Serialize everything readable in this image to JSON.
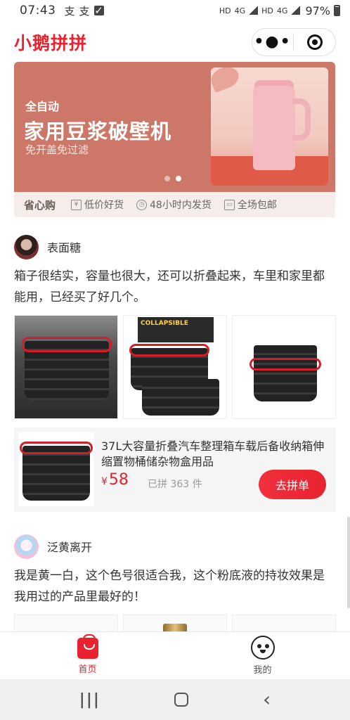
{
  "status_bar": {
    "time": "07:43",
    "notif_glyphs": [
      "支",
      "支"
    ],
    "net1": "HD",
    "net2": "4G",
    "net3": "HD",
    "net4": "4G",
    "battery": "97%"
  },
  "header": {
    "title": "小鹅拼拼",
    "more_glyph": "•●•"
  },
  "banner": {
    "small": "全自动",
    "headline": "家用豆浆破壁机",
    "subline": "免开盖免过滤",
    "slide_count": 2,
    "active_slide": 2
  },
  "features": {
    "title": "省心购",
    "items": [
      "低价好货",
      "48小时内发货",
      "全场包邮"
    ]
  },
  "posts": [
    {
      "author": "表面糖",
      "text": "箱子很结实，容量也很大，还可以折叠起来，车里和家里都能用，已经买了好几个。",
      "image_label": "COLLAPSIBLE",
      "product": {
        "name": "37L大容量折叠汽车整理箱车载后备收纳箱伸缩置物桶储杂物盒用品",
        "currency": "¥",
        "price": "58",
        "sold": "已拼 363 件",
        "buy_label": "去拼单"
      }
    },
    {
      "author": "泛黄离开",
      "text": "我是黄一白，这个色号很适合我，这个粉底液的持妆效果是我用过的产品里最好的！"
    }
  ],
  "tabbar": {
    "home": "首页",
    "me": "我的"
  },
  "navbar": {
    "recent": "|||",
    "back": "‹"
  },
  "colors": {
    "brand_red": "#e8232f",
    "banner_bg": "#cc7767",
    "feature_bg": "#f4ede9"
  }
}
